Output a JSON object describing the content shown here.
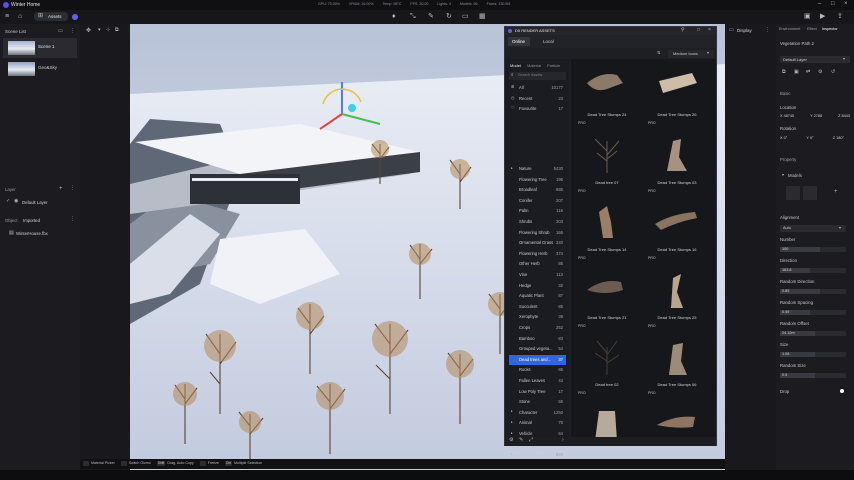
{
  "app": {
    "title": "Winter Home",
    "assets_label": "Assets",
    "render_info": [
      "GPU: 70.00%",
      "VRAM: 16.00%",
      "Temp: 58°C",
      "FPS: 30.00",
      "Lights: 4",
      "Models: 56",
      "Faces: 130.5M"
    ]
  },
  "left": {
    "scene_list_label": "Scene List",
    "scenes": [
      {
        "name": "Scene 1"
      },
      {
        "name": "Geo&Sky"
      }
    ],
    "layer_label": "Layer",
    "default_layer": "Default Layer",
    "object_label": "Object",
    "imported_label": "Imported",
    "file": "WinterHouse.fbx"
  },
  "assets": {
    "title": "D5 RENDER ASSETS",
    "tabs": [
      "Online",
      "Local"
    ],
    "sort": "Medium Icons",
    "sub_tabs": [
      "Model",
      "Material",
      "Particle"
    ],
    "search_placeholder": "Search Assets",
    "top_items": [
      {
        "name": "All",
        "count": "10177"
      },
      {
        "name": "Recent",
        "count": "23"
      },
      {
        "name": "Favourite",
        "count": "17"
      }
    ],
    "categories": [
      {
        "name": "Nature",
        "count": "5430"
      },
      {
        "name": "Flowering Tree",
        "count": "196"
      },
      {
        "name": "Broadleaf",
        "count": "686"
      },
      {
        "name": "Conifer",
        "count": "207"
      },
      {
        "name": "Palm",
        "count": "116"
      },
      {
        "name": "Shrubs",
        "count": "303"
      },
      {
        "name": "Flowering Shrub",
        "count": "166"
      },
      {
        "name": "Ornamental Grass",
        "count": "340"
      },
      {
        "name": "Flowering Herb",
        "count": "374"
      },
      {
        "name": "Other Herb",
        "count": "85"
      },
      {
        "name": "Vine",
        "count": "113"
      },
      {
        "name": "Hedge",
        "count": "32"
      },
      {
        "name": "Aquatic Plant",
        "count": "87"
      },
      {
        "name": "Succulent",
        "count": "86"
      },
      {
        "name": "Xerophyte",
        "count": "39"
      },
      {
        "name": "Crops",
        "count": "252"
      },
      {
        "name": "Bamboo",
        "count": "83"
      },
      {
        "name": "Grouped vegeta...",
        "count": "54"
      },
      {
        "name": "Dead trees and...",
        "count": "37"
      },
      {
        "name": "Rocks",
        "count": "86"
      },
      {
        "name": "Fallen Leaves",
        "count": "43"
      },
      {
        "name": "Low Poly Tree",
        "count": "17"
      },
      {
        "name": "Stone",
        "count": "55"
      },
      {
        "name": "Character",
        "count": "1250"
      },
      {
        "name": "Animal",
        "count": "78"
      },
      {
        "name": "Vehicle",
        "count": "64"
      },
      {
        "name": "Furniture",
        "count": "2058"
      },
      {
        "name": "Accessories",
        "count": "820"
      }
    ],
    "selected_category": "Dead trees and...",
    "items": [
      {
        "name": "Dead Tree Stumps 24",
        "pro": "PRO"
      },
      {
        "name": "Dead Tree Stumps 26",
        "pro": "PRO"
      },
      {
        "name": "Dead tree 07",
        "pro": "PRO"
      },
      {
        "name": "Dead Tree Stumps 03",
        "pro": "PRO"
      },
      {
        "name": "Dead Tree Stumps 14",
        "pro": "PRO"
      },
      {
        "name": "Dead Tree Stumps 16",
        "pro": "PRO"
      },
      {
        "name": "Dead Tree Stumps 21",
        "pro": "PRO"
      },
      {
        "name": "Dead Tree Stumps 25",
        "pro": "PRO"
      },
      {
        "name": "Dead tree 02",
        "pro": "PRO"
      },
      {
        "name": "Dead Tree Stumps 06",
        "pro": "PRO"
      },
      {
        "name": "",
        "pro": ""
      },
      {
        "name": "",
        "pro": ""
      }
    ]
  },
  "inspector": {
    "tabs": [
      "Environment",
      "Effect",
      "Inspector"
    ],
    "name": "Vegetation Path 2",
    "layer": "Default Layer",
    "basic": "Basic",
    "location": "Location",
    "loc": [
      "X 48745",
      "Y 2788",
      "Z 8443"
    ],
    "rotation": "Rotation",
    "rot": [
      "X 0°",
      "Y 0°",
      "Z 180°"
    ],
    "property": "Property",
    "models": "Models",
    "alignment": "Alignment",
    "alignment_val": "Auto",
    "number": "Number",
    "number_val": "100",
    "direction": "Direction",
    "direction_val": "163.8",
    "random_direction": "Random Direction",
    "random_direction_val": "0.85",
    "random_spacing": "Random Spacing",
    "random_spacing_val": "0.49",
    "random_offset": "Random Offset",
    "random_offset_val": "24.12m",
    "size": "Size",
    "size_val": "1.08",
    "random_size": "Random Size",
    "random_size_val": "0.5",
    "drop": "Drop"
  },
  "display_label": "Display",
  "status": [
    {
      "key": "",
      "label": "Material Picker"
    },
    {
      "key": "",
      "label": "Switch Gizmo"
    },
    {
      "key": "Shift",
      "label": "Drag, Auto Copy"
    },
    {
      "key": "",
      "label": "Freeze"
    },
    {
      "key": "Ctrl",
      "label": "Multiple Selection"
    }
  ]
}
